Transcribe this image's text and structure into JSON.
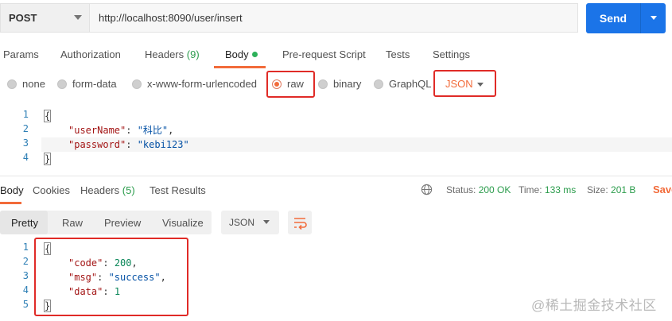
{
  "request": {
    "method": "POST",
    "url": "http://localhost:8090/user/insert",
    "send_label": "Send"
  },
  "tabs": [
    {
      "label": "Params"
    },
    {
      "label": "Authorization"
    },
    {
      "label": "Headers",
      "count": "(9)"
    },
    {
      "label": "Body",
      "active": true
    },
    {
      "label": "Pre-request Script"
    },
    {
      "label": "Tests"
    },
    {
      "label": "Settings"
    }
  ],
  "body_types": [
    {
      "label": "none"
    },
    {
      "label": "form-data"
    },
    {
      "label": "x-www-form-urlencoded"
    },
    {
      "label": "raw",
      "selected": true
    },
    {
      "label": "binary"
    },
    {
      "label": "GraphQL"
    }
  ],
  "body_format": "JSON",
  "request_body": {
    "line_numbers": [
      "1",
      "2",
      "3",
      "4"
    ],
    "open_brace": "{",
    "close_brace": "}",
    "fields": [
      {
        "key": "\"userName\"",
        "value": "\"科比\"",
        "trail": ","
      },
      {
        "key": "\"password\"",
        "value": "\"kebi123\"",
        "trail": ""
      }
    ]
  },
  "response_tabs": [
    {
      "label": "Body",
      "active": true
    },
    {
      "label": "Cookies"
    },
    {
      "label": "Headers",
      "count": "(5)"
    },
    {
      "label": "Test Results"
    }
  ],
  "response_status": {
    "status_label": "Status:",
    "status_value": "200 OK",
    "time_label": "Time:",
    "time_value": "133 ms",
    "size_label": "Size:",
    "size_value": "201 B",
    "save_label": "Save"
  },
  "view_modes": [
    {
      "label": "Pretty",
      "active": true
    },
    {
      "label": "Raw"
    },
    {
      "label": "Preview"
    },
    {
      "label": "Visualize"
    }
  ],
  "response_format": "JSON",
  "response_body": {
    "line_numbers": [
      "1",
      "2",
      "3",
      "4",
      "5"
    ],
    "open_brace": "{",
    "close_brace": "}",
    "fields": [
      {
        "key": "\"code\"",
        "value": "200",
        "kind": "num",
        "trail": ","
      },
      {
        "key": "\"msg\"",
        "value": "\"success\"",
        "kind": "str",
        "trail": ","
      },
      {
        "key": "\"data\"",
        "value": "1",
        "kind": "num",
        "trail": ""
      }
    ]
  },
  "watermark": "@稀土掘金技术社区",
  "colors": {
    "accent": "#f26b3a",
    "send": "#1b74e8",
    "highlight_box": "#e02b27",
    "ok": "#2b9c4c"
  }
}
